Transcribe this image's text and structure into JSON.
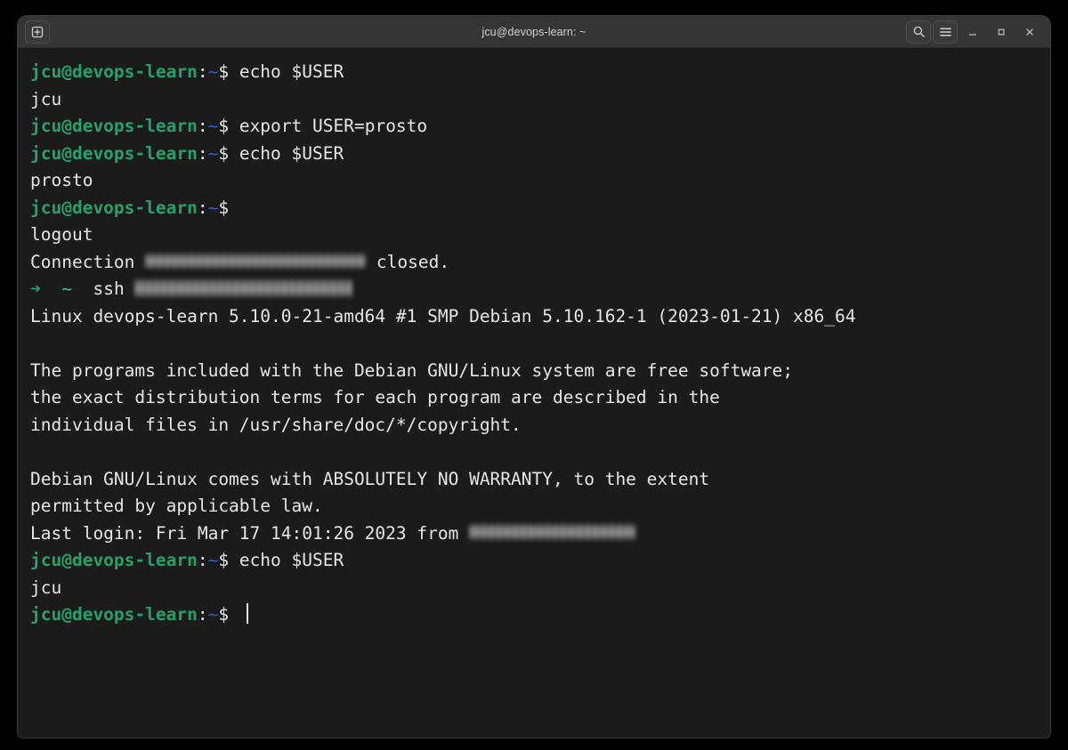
{
  "window": {
    "title": "jcu@devops-learn: ~",
    "titlebar": {
      "new_tab_label": "+",
      "buttons": [
        {
          "name": "search-button",
          "glyph": "search-icon"
        },
        {
          "name": "menu-button",
          "glyph": "hamburger-icon"
        },
        {
          "name": "minimize-button",
          "glyph": "minimize-icon"
        },
        {
          "name": "maximize-button",
          "glyph": "maximize-icon"
        },
        {
          "name": "close-button",
          "glyph": "close-icon"
        }
      ]
    },
    "colors": {
      "desktop_background": "#000000",
      "titlebar_background": "#353535",
      "terminal_background": "#1b1b1b",
      "foreground": "#e6e6e6",
      "prompt_user_green": "#26a269",
      "prompt_path_blue": "#2a5ed0",
      "accent_arrow_green": "#26a269",
      "accent_tilde_cyan": "#2ec7a0"
    }
  },
  "prompt": {
    "user_host": "jcu@devops-learn",
    "colon": ":",
    "path": "~",
    "sigil": "$",
    "arrow": "➜",
    "short_path": "~"
  },
  "terminal": {
    "lines": [
      {
        "type": "prompt",
        "command": "echo $USER"
      },
      {
        "type": "output",
        "text": "jcu"
      },
      {
        "type": "prompt",
        "command": "export USER=prosto"
      },
      {
        "type": "prompt",
        "command": "echo $USER"
      },
      {
        "type": "output",
        "text": "prosto"
      },
      {
        "type": "prompt",
        "command": ""
      },
      {
        "type": "output",
        "text": "logout"
      },
      {
        "type": "redact-conn",
        "before": "Connection ",
        "after": "closed."
      },
      {
        "type": "redact-ssh",
        "command": "ssh "
      },
      {
        "type": "output",
        "text": "Linux devops-learn 5.10.0-21-amd64 #1 SMP Debian 5.10.162-1 (2023-01-21) x86_64"
      },
      {
        "type": "blank",
        "text": ""
      },
      {
        "type": "output",
        "text": "The programs included with the Debian GNU/Linux system are free software;"
      },
      {
        "type": "output",
        "text": "the exact distribution terms for each program are described in the"
      },
      {
        "type": "output",
        "text": "individual files in /usr/share/doc/*/copyright."
      },
      {
        "type": "blank",
        "text": ""
      },
      {
        "type": "output",
        "text": "Debian GNU/Linux comes with ABSOLUTELY NO WARRANTY, to the extent"
      },
      {
        "type": "output",
        "text": "permitted by applicable law."
      },
      {
        "type": "redact-login",
        "before": "Last login: Fri Mar 17 14:01:26 2023 from "
      },
      {
        "type": "prompt",
        "command": "echo $USER"
      },
      {
        "type": "output",
        "text": "jcu"
      },
      {
        "type": "prompt-cursor",
        "command": ""
      }
    ]
  }
}
